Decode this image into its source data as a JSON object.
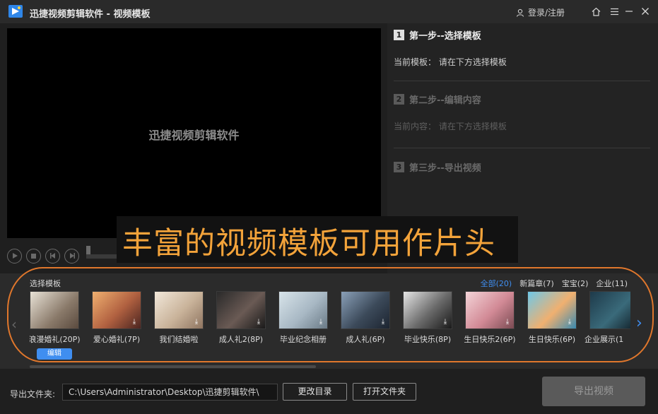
{
  "titlebar": {
    "title": "迅捷视频剪辑软件 - 视频模板",
    "login": "登录/注册",
    "icons": [
      "user-icon",
      "home-icon",
      "menu-icon",
      "minimize-icon",
      "close-icon"
    ]
  },
  "preview": {
    "watermark": "迅捷视频剪辑软件"
  },
  "steps": {
    "step1": {
      "num": "1",
      "title": "第一步--选择模板",
      "info": "当前模板：  请在下方选择模板"
    },
    "step2": {
      "num": "2",
      "title": "第二步--编辑内容",
      "info": "当前内容：  请在下方选择模板"
    },
    "step3": {
      "num": "3",
      "title": "第三步--导出视频"
    }
  },
  "overlay": {
    "text": "丰富的视频模板可用作片头"
  },
  "templates": {
    "label": "选择模板",
    "filters": [
      "全部(20)",
      "新篇章(7)",
      "宝宝(2)",
      "企业(11)"
    ],
    "items": [
      "浪漫婚礼(20P)",
      "爱心婚礼(7P)",
      "我们结婚啦",
      "成人礼2(8P)",
      "毕业纪念相册",
      "成人礼(6P)",
      "毕业快乐(8P)",
      "生日快乐2(6P)",
      "生日快乐(6P)",
      "企业展示(1"
    ],
    "edit_label": "编辑"
  },
  "bottom": {
    "export_label": "导出文件夹:",
    "path": "C:\\Users\\Administrator\\Desktop\\迅捷剪辑软件\\",
    "change_dir": "更改目录",
    "open_folder": "打开文件夹",
    "export_video": "导出视频"
  },
  "colors": {
    "accent": "#3f8ef0",
    "overlay_text": "#f3a33a",
    "ring": "#e0772c"
  }
}
